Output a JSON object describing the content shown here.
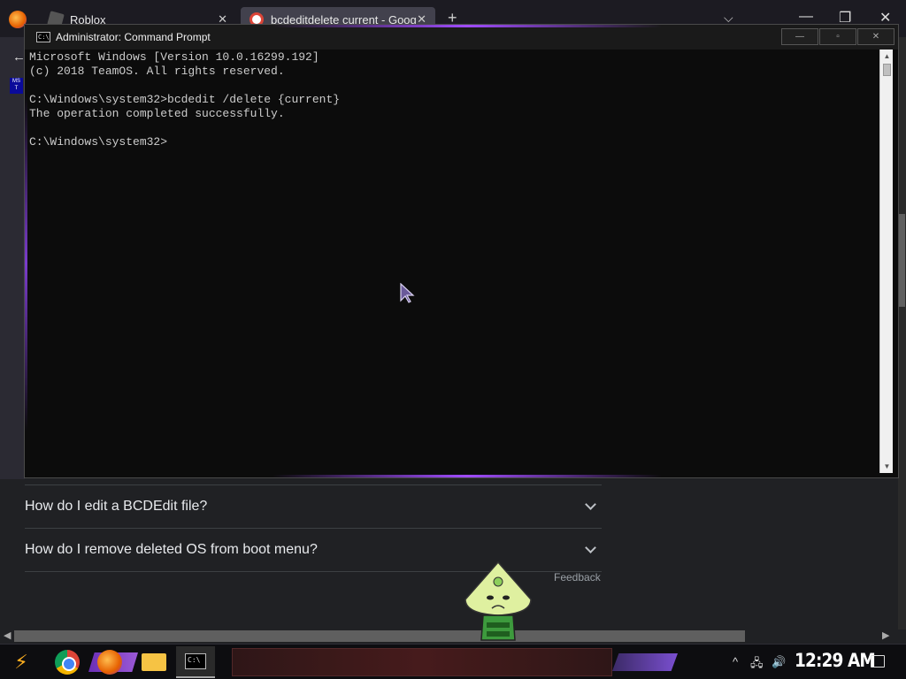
{
  "browser": {
    "tabs": [
      {
        "title": "Roblox",
        "close": "✕"
      },
      {
        "title": "bcdeditdelete current - Goog",
        "close": "✕"
      }
    ],
    "new_tab": "+",
    "tab_list": "⌵",
    "window_controls": {
      "minimize": "—",
      "restore": "❐",
      "close": "✕"
    },
    "back": "←",
    "faq": [
      {
        "question": "How do I edit a BCDEdit file?"
      },
      {
        "question": "How do I remove deleted OS from boot menu?"
      }
    ],
    "feedback": "Feedback"
  },
  "cmd": {
    "title": "Administrator: Command Prompt",
    "icon_text": "C:\\",
    "buttons": {
      "minimize": "—",
      "maximize": "▫",
      "close": "✕"
    },
    "lines": [
      "Microsoft Windows [Version 10.0.16299.192]",
      "(c) 2018 TeamOS. All rights reserved.",
      "",
      "C:\\Windows\\system32>bcdedit /delete {current}",
      "The operation completed successfully.",
      "",
      "C:\\Windows\\system32>"
    ]
  },
  "taskbar": {
    "clock": "12:29 AM",
    "cmd_icon_text": "C:\\",
    "tray": {
      "chevron": "^",
      "network": "🖧",
      "volume": "🔊"
    }
  },
  "colors": {
    "accent": "#a04cff",
    "cmd_text": "#cccccc",
    "cmd_bg": "#0c0c0c"
  }
}
